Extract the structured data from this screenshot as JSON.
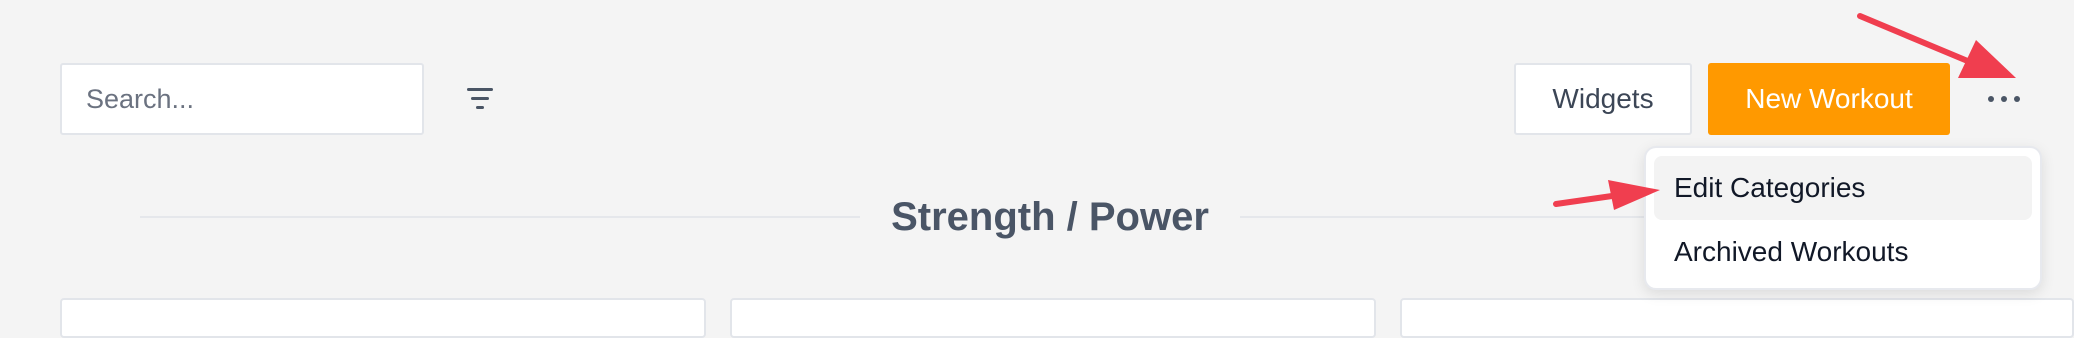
{
  "toolbar": {
    "search_placeholder": "Search...",
    "filter_icon": "filter-icon",
    "widgets_label": "Widgets",
    "new_workout_label": "New Workout",
    "more_icon": "more-horizontal-icon"
  },
  "menu": {
    "items": [
      {
        "label": "Edit Categories",
        "highlighted": true
      },
      {
        "label": "Archived Workouts",
        "highlighted": false
      }
    ]
  },
  "section": {
    "title": "Strength / Power"
  },
  "colors": {
    "background": "#f4f4f4",
    "primary_button": "#ff9900",
    "annotation_arrow": "#f03e4f"
  }
}
